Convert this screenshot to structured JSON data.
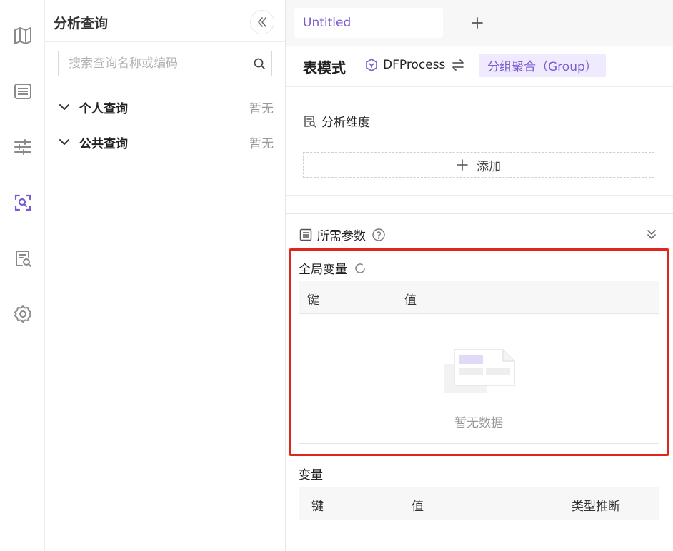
{
  "rail": {
    "items": [
      {
        "icon": "map-icon",
        "active": false
      },
      {
        "icon": "list-icon",
        "active": false
      },
      {
        "icon": "sliders-icon",
        "active": false
      },
      {
        "icon": "scan-search-icon",
        "active": true
      },
      {
        "icon": "document-search-icon",
        "active": false
      },
      {
        "icon": "gear-icon",
        "active": false
      }
    ]
  },
  "panel": {
    "title": "分析查询",
    "search": {
      "placeholder": "搜索查询名称或编码",
      "value": ""
    },
    "groups": [
      {
        "label": "个人查询",
        "status": "暂无"
      },
      {
        "label": "公共查询",
        "status": "暂无"
      }
    ]
  },
  "tabs": {
    "items": [
      {
        "label": "Untitled",
        "active": true
      }
    ],
    "add_label": "+"
  },
  "header": {
    "mode_title": "表模式",
    "process_name": "DFProcess",
    "group_tag": "分组聚合（Group）"
  },
  "dimensions": {
    "title": "分析维度",
    "add_label": "添加"
  },
  "params": {
    "title": "所需参数",
    "global_vars": {
      "title": "全局变量",
      "columns": [
        "键",
        "值"
      ],
      "empty_text": "暂无数据"
    },
    "vars": {
      "title": "变量",
      "columns": [
        "键",
        "值",
        "类型推断"
      ]
    }
  },
  "colors": {
    "accent": "#7a5bd1",
    "accent_bg": "#efeafe",
    "highlight_border": "#e0251b",
    "icon_gray": "#8a8a8a"
  }
}
